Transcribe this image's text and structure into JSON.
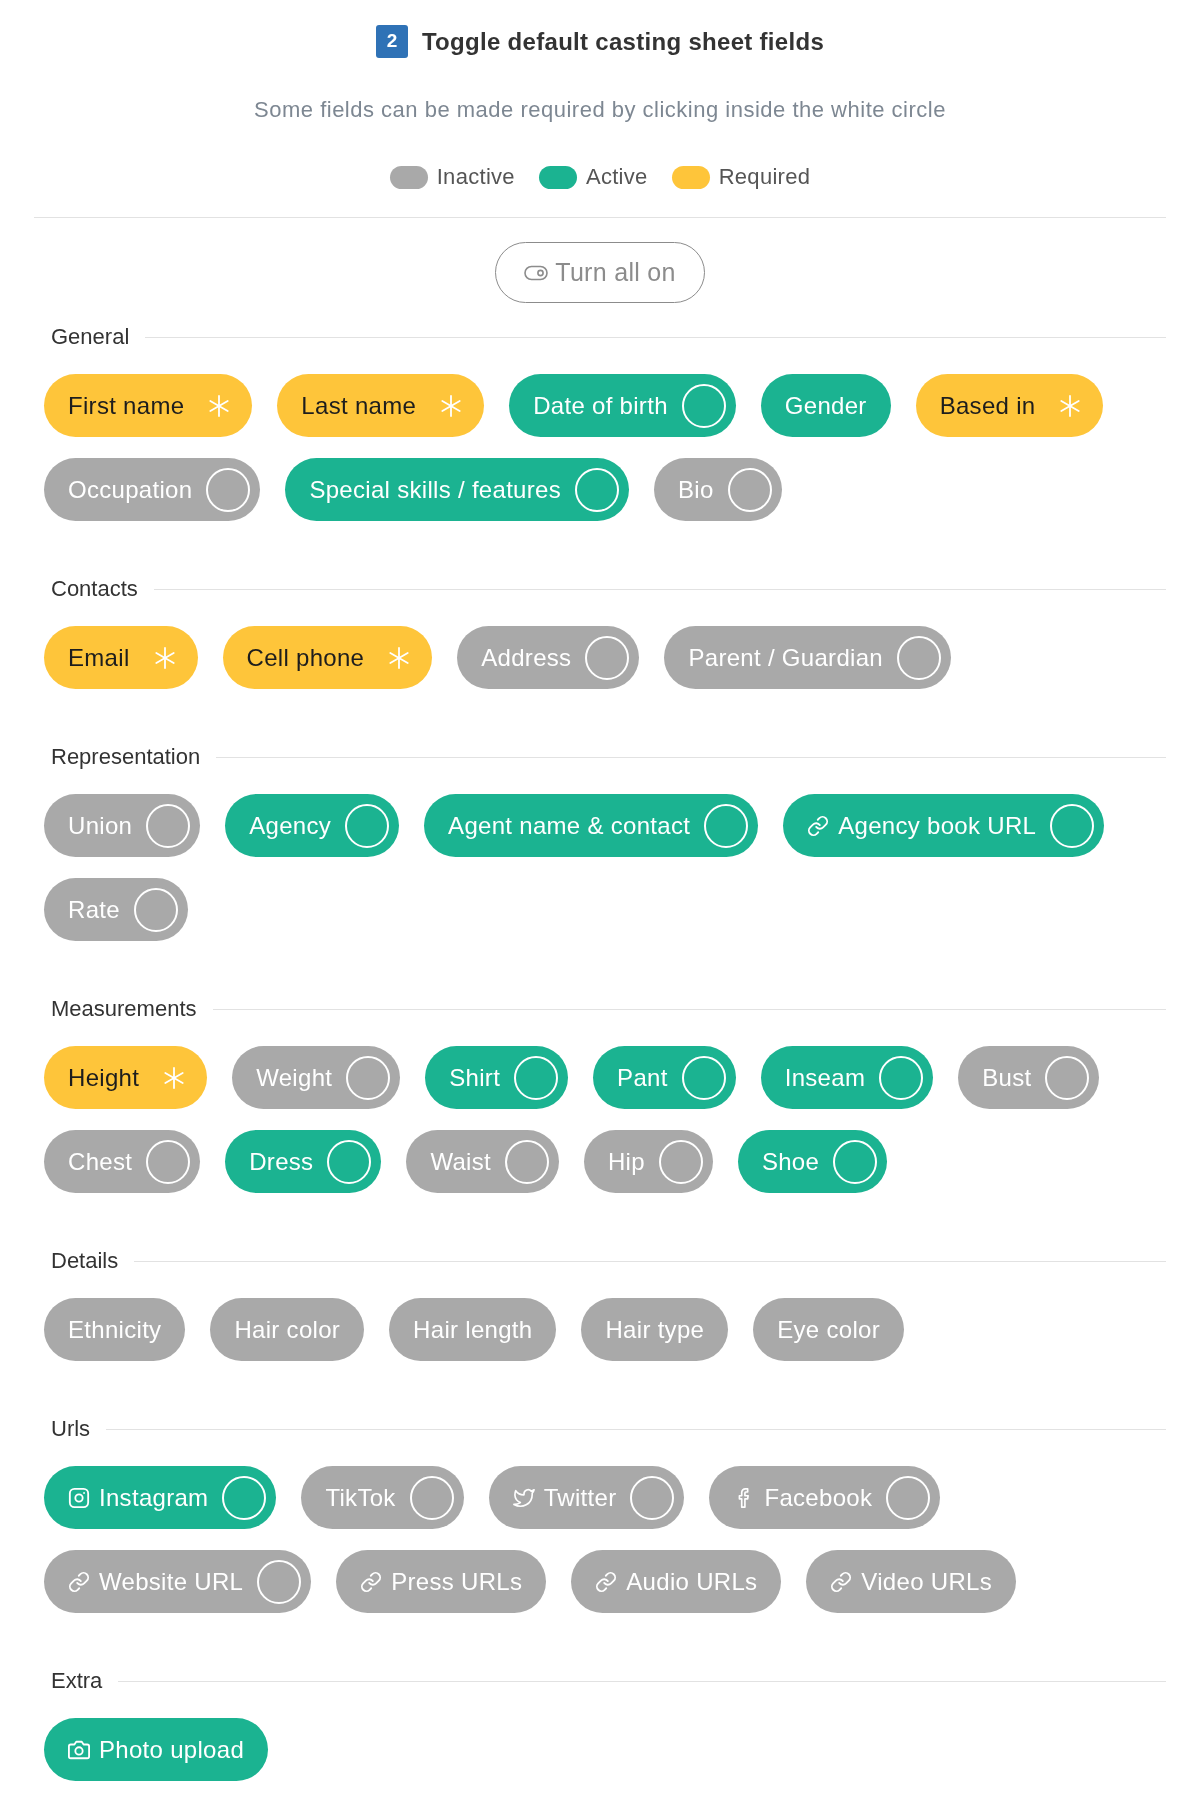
{
  "header": {
    "step": "2",
    "title": "Toggle default casting sheet fields",
    "subtitle": "Some fields can be made required by clicking inside the white circle"
  },
  "legend": [
    {
      "label": "Inactive",
      "color": "#a9a9a9"
    },
    {
      "label": "Active",
      "color": "#1bb391"
    },
    {
      "label": "Required",
      "color": "#fec53a"
    }
  ],
  "turn_all_button": {
    "label": "Turn all on"
  },
  "sections": [
    {
      "title": "General",
      "fields": [
        {
          "label": "First name",
          "kind": "plain",
          "active": true,
          "requirable": true,
          "required": true
        },
        {
          "label": "Last name",
          "kind": "plain",
          "active": true,
          "requirable": true,
          "required": true
        },
        {
          "label": "Date of birth",
          "kind": "plain",
          "active": true,
          "requirable": true,
          "required": false
        },
        {
          "label": "Gender",
          "kind": "plain",
          "active": true,
          "requirable": false
        },
        {
          "label": "Based in",
          "kind": "plain",
          "active": true,
          "requirable": true,
          "required": true
        },
        {
          "label": "Occupation",
          "kind": "plain",
          "active": false,
          "requirable": true,
          "required": false
        },
        {
          "label": "Special skills / features",
          "kind": "plain",
          "active": true,
          "requirable": true,
          "required": false
        },
        {
          "label": "Bio",
          "kind": "plain",
          "active": false,
          "requirable": true,
          "required": false
        }
      ]
    },
    {
      "title": "Contacts",
      "fields": [
        {
          "label": "Email",
          "kind": "plain",
          "active": true,
          "requirable": true,
          "required": true
        },
        {
          "label": "Cell phone",
          "kind": "plain",
          "active": true,
          "requirable": true,
          "required": true
        },
        {
          "label": "Address",
          "kind": "plain",
          "active": false,
          "requirable": true,
          "required": false
        },
        {
          "label": "Parent / Guardian",
          "kind": "plain",
          "active": false,
          "requirable": true,
          "required": false
        }
      ]
    },
    {
      "title": "Representation",
      "fields": [
        {
          "label": "Union",
          "kind": "plain",
          "active": false,
          "requirable": true,
          "required": false
        },
        {
          "label": "Agency",
          "kind": "plain",
          "active": true,
          "requirable": true,
          "required": false
        },
        {
          "label": "Agent name & contact",
          "kind": "plain",
          "active": true,
          "requirable": true,
          "required": false
        },
        {
          "label": "Agency book URL",
          "kind": "link",
          "active": true,
          "requirable": true,
          "required": false
        },
        {
          "label": "Rate",
          "kind": "plain",
          "active": false,
          "requirable": true,
          "required": false
        }
      ]
    },
    {
      "title": "Measurements",
      "fields": [
        {
          "label": "Height",
          "kind": "plain",
          "active": true,
          "requirable": true,
          "required": true
        },
        {
          "label": "Weight",
          "kind": "plain",
          "active": false,
          "requirable": true,
          "required": false
        },
        {
          "label": "Shirt",
          "kind": "plain",
          "active": true,
          "requirable": true,
          "required": false
        },
        {
          "label": "Pant",
          "kind": "plain",
          "active": true,
          "requirable": true,
          "required": false
        },
        {
          "label": "Inseam",
          "kind": "plain",
          "active": true,
          "requirable": true,
          "required": false
        },
        {
          "label": "Bust",
          "kind": "plain",
          "active": false,
          "requirable": true,
          "required": false
        },
        {
          "label": "Chest",
          "kind": "plain",
          "active": false,
          "requirable": true,
          "required": false
        },
        {
          "label": "Dress",
          "kind": "plain",
          "active": true,
          "requirable": true,
          "required": false
        },
        {
          "label": "Waist",
          "kind": "plain",
          "active": false,
          "requirable": true,
          "required": false
        },
        {
          "label": "Hip",
          "kind": "plain",
          "active": false,
          "requirable": true,
          "required": false
        },
        {
          "label": "Shoe",
          "kind": "plain",
          "active": true,
          "requirable": true,
          "required": false
        }
      ]
    },
    {
      "title": "Details",
      "fields": [
        {
          "label": "Ethnicity",
          "kind": "plain",
          "active": false,
          "requirable": false
        },
        {
          "label": "Hair color",
          "kind": "plain",
          "active": false,
          "requirable": false
        },
        {
          "label": "Hair length",
          "kind": "plain",
          "active": false,
          "requirable": false
        },
        {
          "label": "Hair type",
          "kind": "plain",
          "active": false,
          "requirable": false
        },
        {
          "label": "Eye color",
          "kind": "plain",
          "active": false,
          "requirable": false
        }
      ]
    },
    {
      "title": "Urls",
      "fields": [
        {
          "label": "Instagram",
          "kind": "instagram",
          "active": true,
          "requirable": true,
          "required": false
        },
        {
          "label": "TikTok",
          "kind": "plain",
          "active": false,
          "requirable": true,
          "required": false
        },
        {
          "label": "Twitter",
          "kind": "twitter",
          "active": false,
          "requirable": true,
          "required": false
        },
        {
          "label": "Facebook",
          "kind": "facebook",
          "active": false,
          "requirable": true,
          "required": false
        },
        {
          "label": "Website URL",
          "kind": "link",
          "active": false,
          "requirable": true,
          "required": false
        },
        {
          "label": "Press URLs",
          "kind": "link",
          "active": false,
          "requirable": false
        },
        {
          "label": "Audio URLs",
          "kind": "link",
          "active": false,
          "requirable": false
        },
        {
          "label": "Video URLs",
          "kind": "link",
          "active": false,
          "requirable": false
        }
      ]
    },
    {
      "title": "Extra",
      "fields": [
        {
          "label": "Photo upload",
          "kind": "photo",
          "active": true,
          "requirable": false
        }
      ]
    }
  ]
}
